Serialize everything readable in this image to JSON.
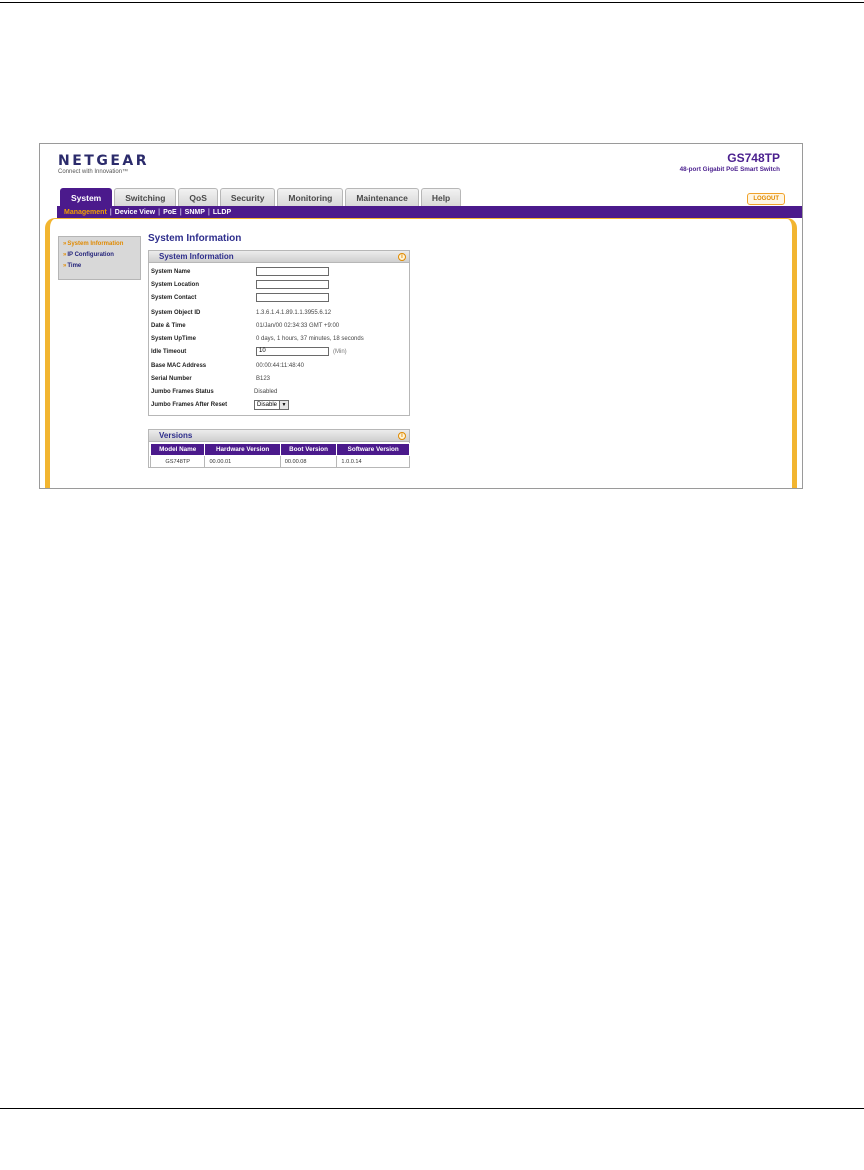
{
  "brand": {
    "logo": "NETGEAR",
    "tagline": "Connect with Innovation™"
  },
  "device": {
    "model": "GS748TP",
    "description": "48-port Gigabit PoE Smart Switch"
  },
  "tabs": [
    {
      "label": "System",
      "active": true
    },
    {
      "label": "Switching",
      "active": false
    },
    {
      "label": "QoS",
      "active": false
    },
    {
      "label": "Security",
      "active": false
    },
    {
      "label": "Monitoring",
      "active": false
    },
    {
      "label": "Maintenance",
      "active": false
    },
    {
      "label": "Help",
      "active": false
    }
  ],
  "logout_label": "LOGOUT",
  "subnav": [
    "Management",
    "Device View",
    "PoE",
    "SNMP",
    "LLDP"
  ],
  "leftnav": [
    "System Information",
    "IP Configuration",
    "Time"
  ],
  "page_title": "System Information",
  "system_panel": {
    "title": "System Information",
    "fields": {
      "system_name": {
        "label": "System Name",
        "value": ""
      },
      "system_location": {
        "label": "System Location",
        "value": ""
      },
      "system_contact": {
        "label": "System Contact",
        "value": ""
      },
      "object_id": {
        "label": "System Object ID",
        "value": "1.3.6.1.4.1.89.1.1.3955.6.12"
      },
      "date_time": {
        "label": "Date & Time",
        "value": "01/Jan/00  02:34:33 GMT +9:00"
      },
      "uptime": {
        "label": "System UpTime",
        "value": "0 days, 1 hours, 37 minutes, 18 seconds"
      },
      "idle_timeout": {
        "label": "Idle Timeout",
        "value": "10",
        "unit": "(Min)"
      },
      "mac": {
        "label": "Base MAC Address",
        "value": "00:00:44:11:48:40"
      },
      "serial": {
        "label": "Serial Number",
        "value": "B123"
      },
      "jumbo_status": {
        "label": "Jumbo Frames Status",
        "value": "Disabled"
      },
      "jumbo_reset": {
        "label": "Jumbo Frames After Reset",
        "value": "Disable"
      }
    }
  },
  "versions_panel": {
    "title": "Versions",
    "headers": [
      "Model Name",
      "Hardware Version",
      "Boot Version",
      "Software Version"
    ],
    "row": [
      "GS748TP",
      "00.00.01",
      "00.00.08",
      "1.0.0.14"
    ]
  },
  "colors": {
    "brand_purple": "#4b1a8c",
    "accent_orange": "#f2b530"
  }
}
